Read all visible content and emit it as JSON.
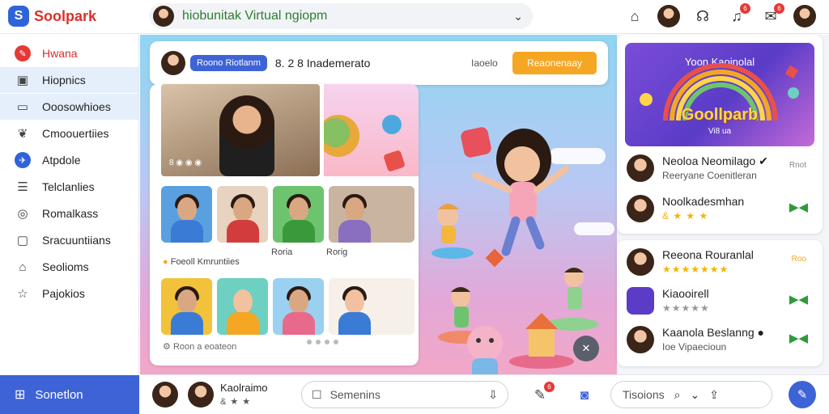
{
  "brand": {
    "name": "Soolpark",
    "logo_letter": "S"
  },
  "search": {
    "value": "hiobunitak Virtual ngiopm",
    "chevron_icon": "chevron-down-icon"
  },
  "topbar": {
    "badges": [
      "6",
      "6"
    ],
    "icons": [
      "home-icon",
      "headset-icon",
      "bell-icon",
      "chat-icon"
    ]
  },
  "sidebar": {
    "items": [
      {
        "label": "Hwana",
        "icon": "brand-icon"
      },
      {
        "label": "Hiopnics",
        "icon": "board-icon"
      },
      {
        "label": "Ooosowhioes",
        "icon": "folder-icon"
      },
      {
        "label": "Cmoouertiies",
        "icon": "leaf-icon"
      },
      {
        "label": "Atpdole",
        "icon": "plane-icon"
      },
      {
        "label": "Telclanlies",
        "icon": "document-icon"
      },
      {
        "label": "Romalkass",
        "icon": "compass-icon"
      },
      {
        "label": "Sracuuntiians",
        "icon": "box-icon"
      },
      {
        "label": "Seolioms",
        "icon": "home-icon"
      },
      {
        "label": "Pajokios",
        "icon": "star-icon"
      }
    ],
    "bottom_label": "Sonetlon"
  },
  "session": {
    "pill": "Roono Riotlanm",
    "title": "8. 2 8 Inademerato",
    "mute_label": "Iaoelo",
    "join_label": "Reaonenaay"
  },
  "panel": {
    "hero_caption": "8 ◉ ◉ ◉",
    "label_1": "Foeoll Kmruntiies",
    "label_2": "Roria",
    "label_3": "Rorig",
    "footer_label": "Roon a eoateon"
  },
  "right_panel": {
    "banner_title": "Yoon Kaoinolal",
    "banner_logo": "Goollparb",
    "banner_sub": "Vi8 ua",
    "rows": [
      {
        "name": "Neoloa Neomilago ✔",
        "sub": "Reeryane Coenitleran",
        "action": "Rnot",
        "action_color": "#888888"
      },
      {
        "name": "Noolkadesmhan",
        "sub": "& ★ ★ ★",
        "action": "▶◀",
        "action_color": "#2e9b3a"
      }
    ],
    "list": [
      {
        "name": "Reeona Rouranlal",
        "sub": "★★★★★★★",
        "action": "Roo",
        "action_color": "#f5a623"
      },
      {
        "name": "Kiaooirell",
        "sub": "★★★★★",
        "action": "▶◀",
        "action_color": "#2e9b3a"
      },
      {
        "name": "Kaanola Beslanng ●",
        "sub": "Ioe Vipaecioun",
        "action": "▶◀",
        "action_color": "#2e9b3a"
      }
    ]
  },
  "bottombar": {
    "user_name": "Kaolraimo",
    "user_stars": "& ★ ★",
    "message_placeholder": "Semenins",
    "translate_label": "Tisoions",
    "badge": "6"
  },
  "colors": {
    "accent": "#3d63d6",
    "brand_red": "#d9322b",
    "join": "#f5a623",
    "go": "#2e9b3a"
  }
}
